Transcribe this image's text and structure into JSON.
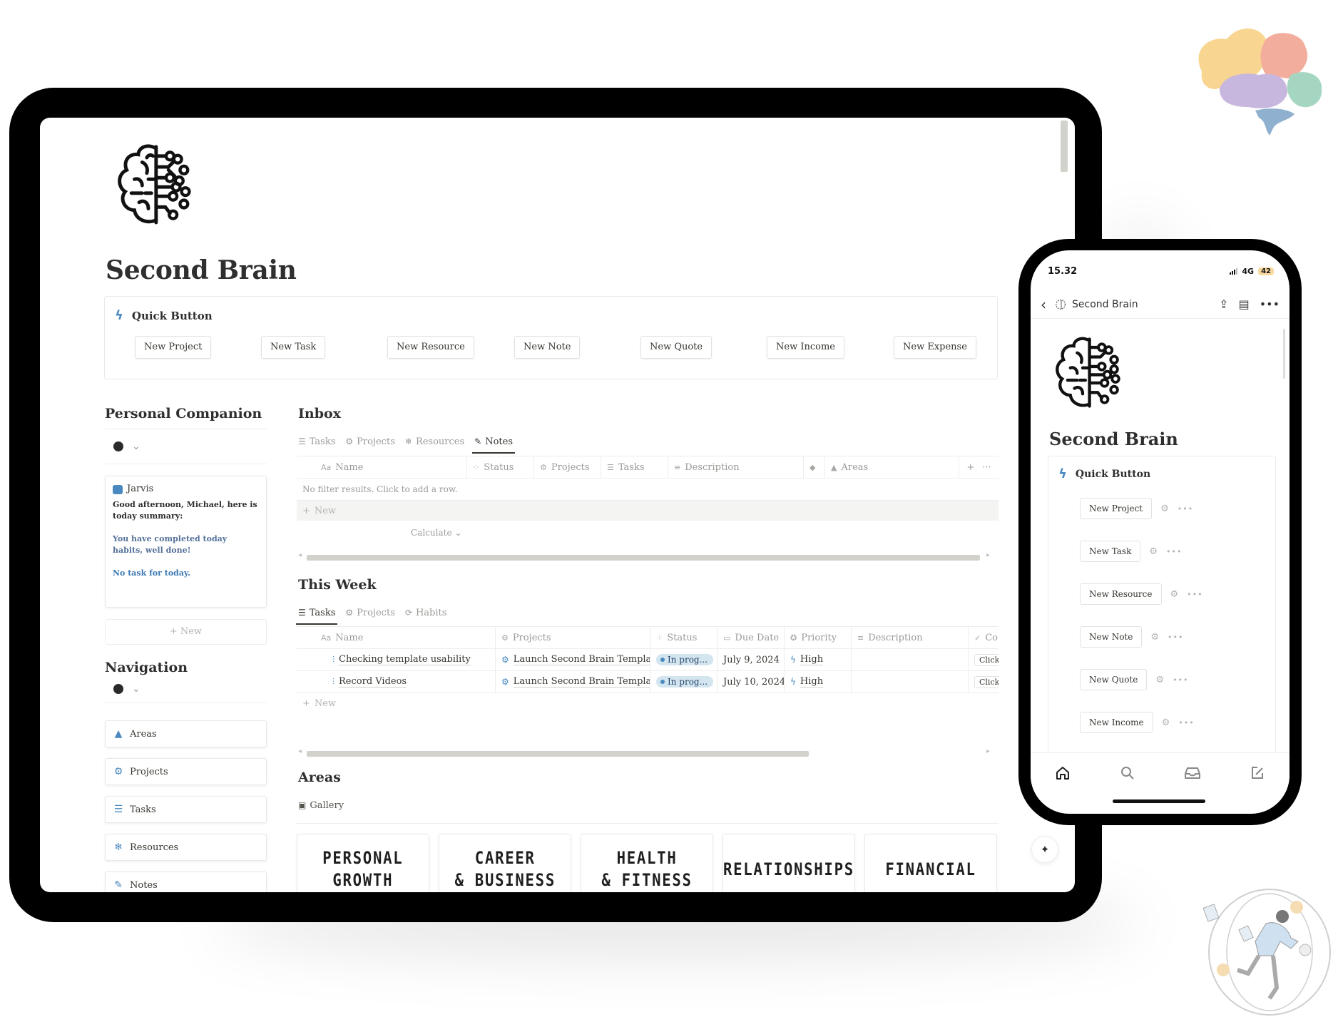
{
  "tablet": {
    "page_title": "Second Brain",
    "quick_button": {
      "title": "Quick Button",
      "icon": "lightning-bolt-icon",
      "buttons": [
        "New Project",
        "New Task",
        "New Resource",
        "New Note",
        "New Quote",
        "New Income",
        "New Expense"
      ]
    },
    "personal_companion": {
      "heading": "Personal Companion",
      "toggle_icon": "robot-icon",
      "card": {
        "name": "Jarvis",
        "greeting": "Good afternoon, Michael, here is today summary:",
        "habits": "You have completed today habits, well done!",
        "tasks": "No task for today."
      },
      "new_label": "+ New"
    },
    "navigation": {
      "heading": "Navigation",
      "toggle_icon": "compass-icon",
      "items": [
        {
          "label": "Areas",
          "icon": "shapes-icon"
        },
        {
          "label": "Projects",
          "icon": "gear-icon"
        },
        {
          "label": "Tasks",
          "icon": "sliders-icon"
        },
        {
          "label": "Resources",
          "icon": "snowflake-icon"
        },
        {
          "label": "Notes",
          "icon": "notes-icon"
        }
      ]
    },
    "inbox": {
      "heading": "Inbox",
      "tabs": [
        {
          "label": "Tasks",
          "icon": "sliders-icon",
          "active": false
        },
        {
          "label": "Projects",
          "icon": "gear-icon",
          "active": false
        },
        {
          "label": "Resources",
          "icon": "snowflake-icon",
          "active": false
        },
        {
          "label": "Notes",
          "icon": "notes-icon",
          "active": true
        }
      ],
      "columns": [
        {
          "label": "Name",
          "icon": "Aa"
        },
        {
          "label": "Status",
          "icon": "status-icon"
        },
        {
          "label": "Projects",
          "icon": "gear-icon"
        },
        {
          "label": "Tasks",
          "icon": "sliders-icon"
        },
        {
          "label": "Description",
          "icon": "text-icon"
        },
        {
          "label": "",
          "icon": "relation-icon"
        },
        {
          "label": "Areas",
          "icon": "shapes-icon"
        }
      ],
      "empty_message": "No filter results. Click to add a row.",
      "new_label": "New",
      "calculate_label": "Calculate",
      "add_column": "+",
      "more": "···"
    },
    "this_week": {
      "heading": "This Week",
      "tabs": [
        {
          "label": "Tasks",
          "icon": "sliders-icon",
          "active": true
        },
        {
          "label": "Projects",
          "icon": "gear-icon",
          "active": false
        },
        {
          "label": "Habits",
          "icon": "repeat-icon",
          "active": false
        }
      ],
      "columns": [
        "Name",
        "Projects",
        "Status",
        "Due Date",
        "Priority",
        "Description",
        "Co"
      ],
      "rows": [
        {
          "name": "Checking template usability",
          "project": "Launch Second Brain Template",
          "status": "In prog...",
          "due": "July 9, 2024",
          "priority": "High",
          "description": "",
          "complete": "Click"
        },
        {
          "name": "Record Videos",
          "project": "Launch Second Brain Template",
          "status": "In prog...",
          "due": "July 10, 2024",
          "priority": "High",
          "description": "",
          "complete": "Click"
        }
      ],
      "new_label": "New"
    },
    "areas": {
      "heading": "Areas",
      "view_label": "Gallery",
      "cards": [
        "PERSONAL\nGROWTH",
        "CAREER\n& BUSINESS",
        "HEALTH\n& FITNESS",
        "RELATIONSHIPS",
        "FINANCIAL"
      ]
    },
    "ai_button_icon": "sparkles-icon"
  },
  "phone": {
    "time": "15.32",
    "network": "4G",
    "battery": "42",
    "breadcrumb": "Second Brain",
    "page_title": "Second Brain",
    "quick_button_title": "Quick Button",
    "buttons": [
      "New Project",
      "New Task",
      "New Resource",
      "New Note",
      "New Quote",
      "New Income"
    ],
    "tabbar": [
      "home-icon",
      "search-icon",
      "inbox-icon",
      "compose-icon"
    ]
  },
  "colors": {
    "accent_blue": "#4a89c0",
    "status_pill": "#d3e5ef",
    "text": "#37352f",
    "muted": "#9b9a97",
    "device_frame": "#000000"
  }
}
